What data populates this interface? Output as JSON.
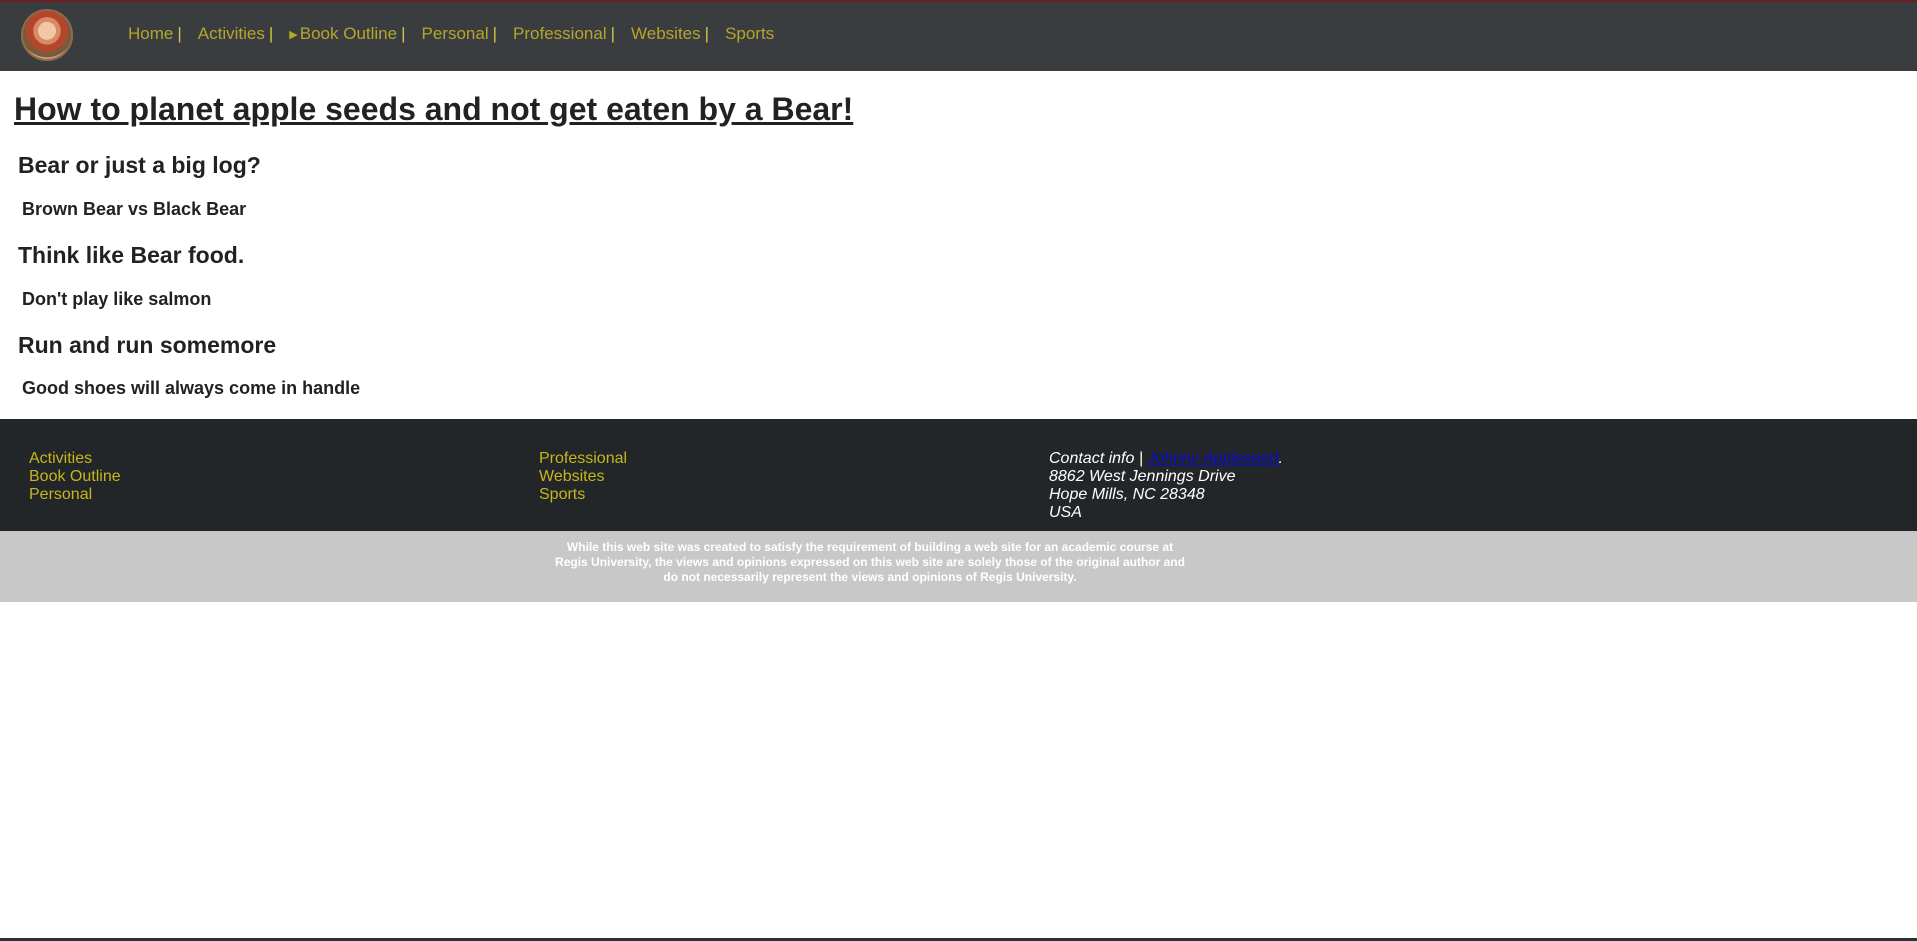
{
  "nav": {
    "items": [
      {
        "label": "Home",
        "sep": "|"
      },
      {
        "label": "Activities",
        "sep": "|"
      },
      {
        "label": "Book Outline",
        "sep": "|",
        "marker": "▶"
      },
      {
        "label": "Personal",
        "sep": "|"
      },
      {
        "label": "Professional",
        "sep": "|"
      },
      {
        "label": "Websites",
        "sep": "|"
      },
      {
        "label": "Sports",
        "sep": ""
      }
    ]
  },
  "main": {
    "title": "How to planet apple seeds and not get eaten by a Bear!",
    "sections": [
      {
        "heading": "Bear or just a big log?",
        "sub": "Brown Bear vs Black Bear"
      },
      {
        "heading": "Think like Bear food.",
        "sub": "Don't play like salmon"
      },
      {
        "heading": "Run and run somemore",
        "sub": "Good shoes will always come in handle"
      }
    ]
  },
  "footer": {
    "col1": [
      "Activities",
      "Book Outline",
      "Personal"
    ],
    "col2": [
      "Professional",
      "Websites",
      "Sports"
    ],
    "contact": {
      "prefix": "Contact info |",
      "name_link": "Johnny Appleseed",
      "suffix": ".",
      "address_line1": "8862 West Jennings Drive",
      "address_line2": "Hope Mills, NC 28348",
      "address_line3": "USA"
    },
    "disclaimer": {
      "line1": "While this web site was created to satisfy the requirement of building a web site for an academic course at",
      "line2": "Regis University, the views and opinions expressed on this web site are solely those of the original author and",
      "line3": "do not necessarily represent the views and opinions of Regis University."
    }
  },
  "colors": {
    "nav_bg": "#3a3d40",
    "nav_link": "#b5a52b",
    "footer_bg": "#222629",
    "footer_link": "#c6b61c",
    "disclaimer_bg": "#c8c8c8"
  }
}
